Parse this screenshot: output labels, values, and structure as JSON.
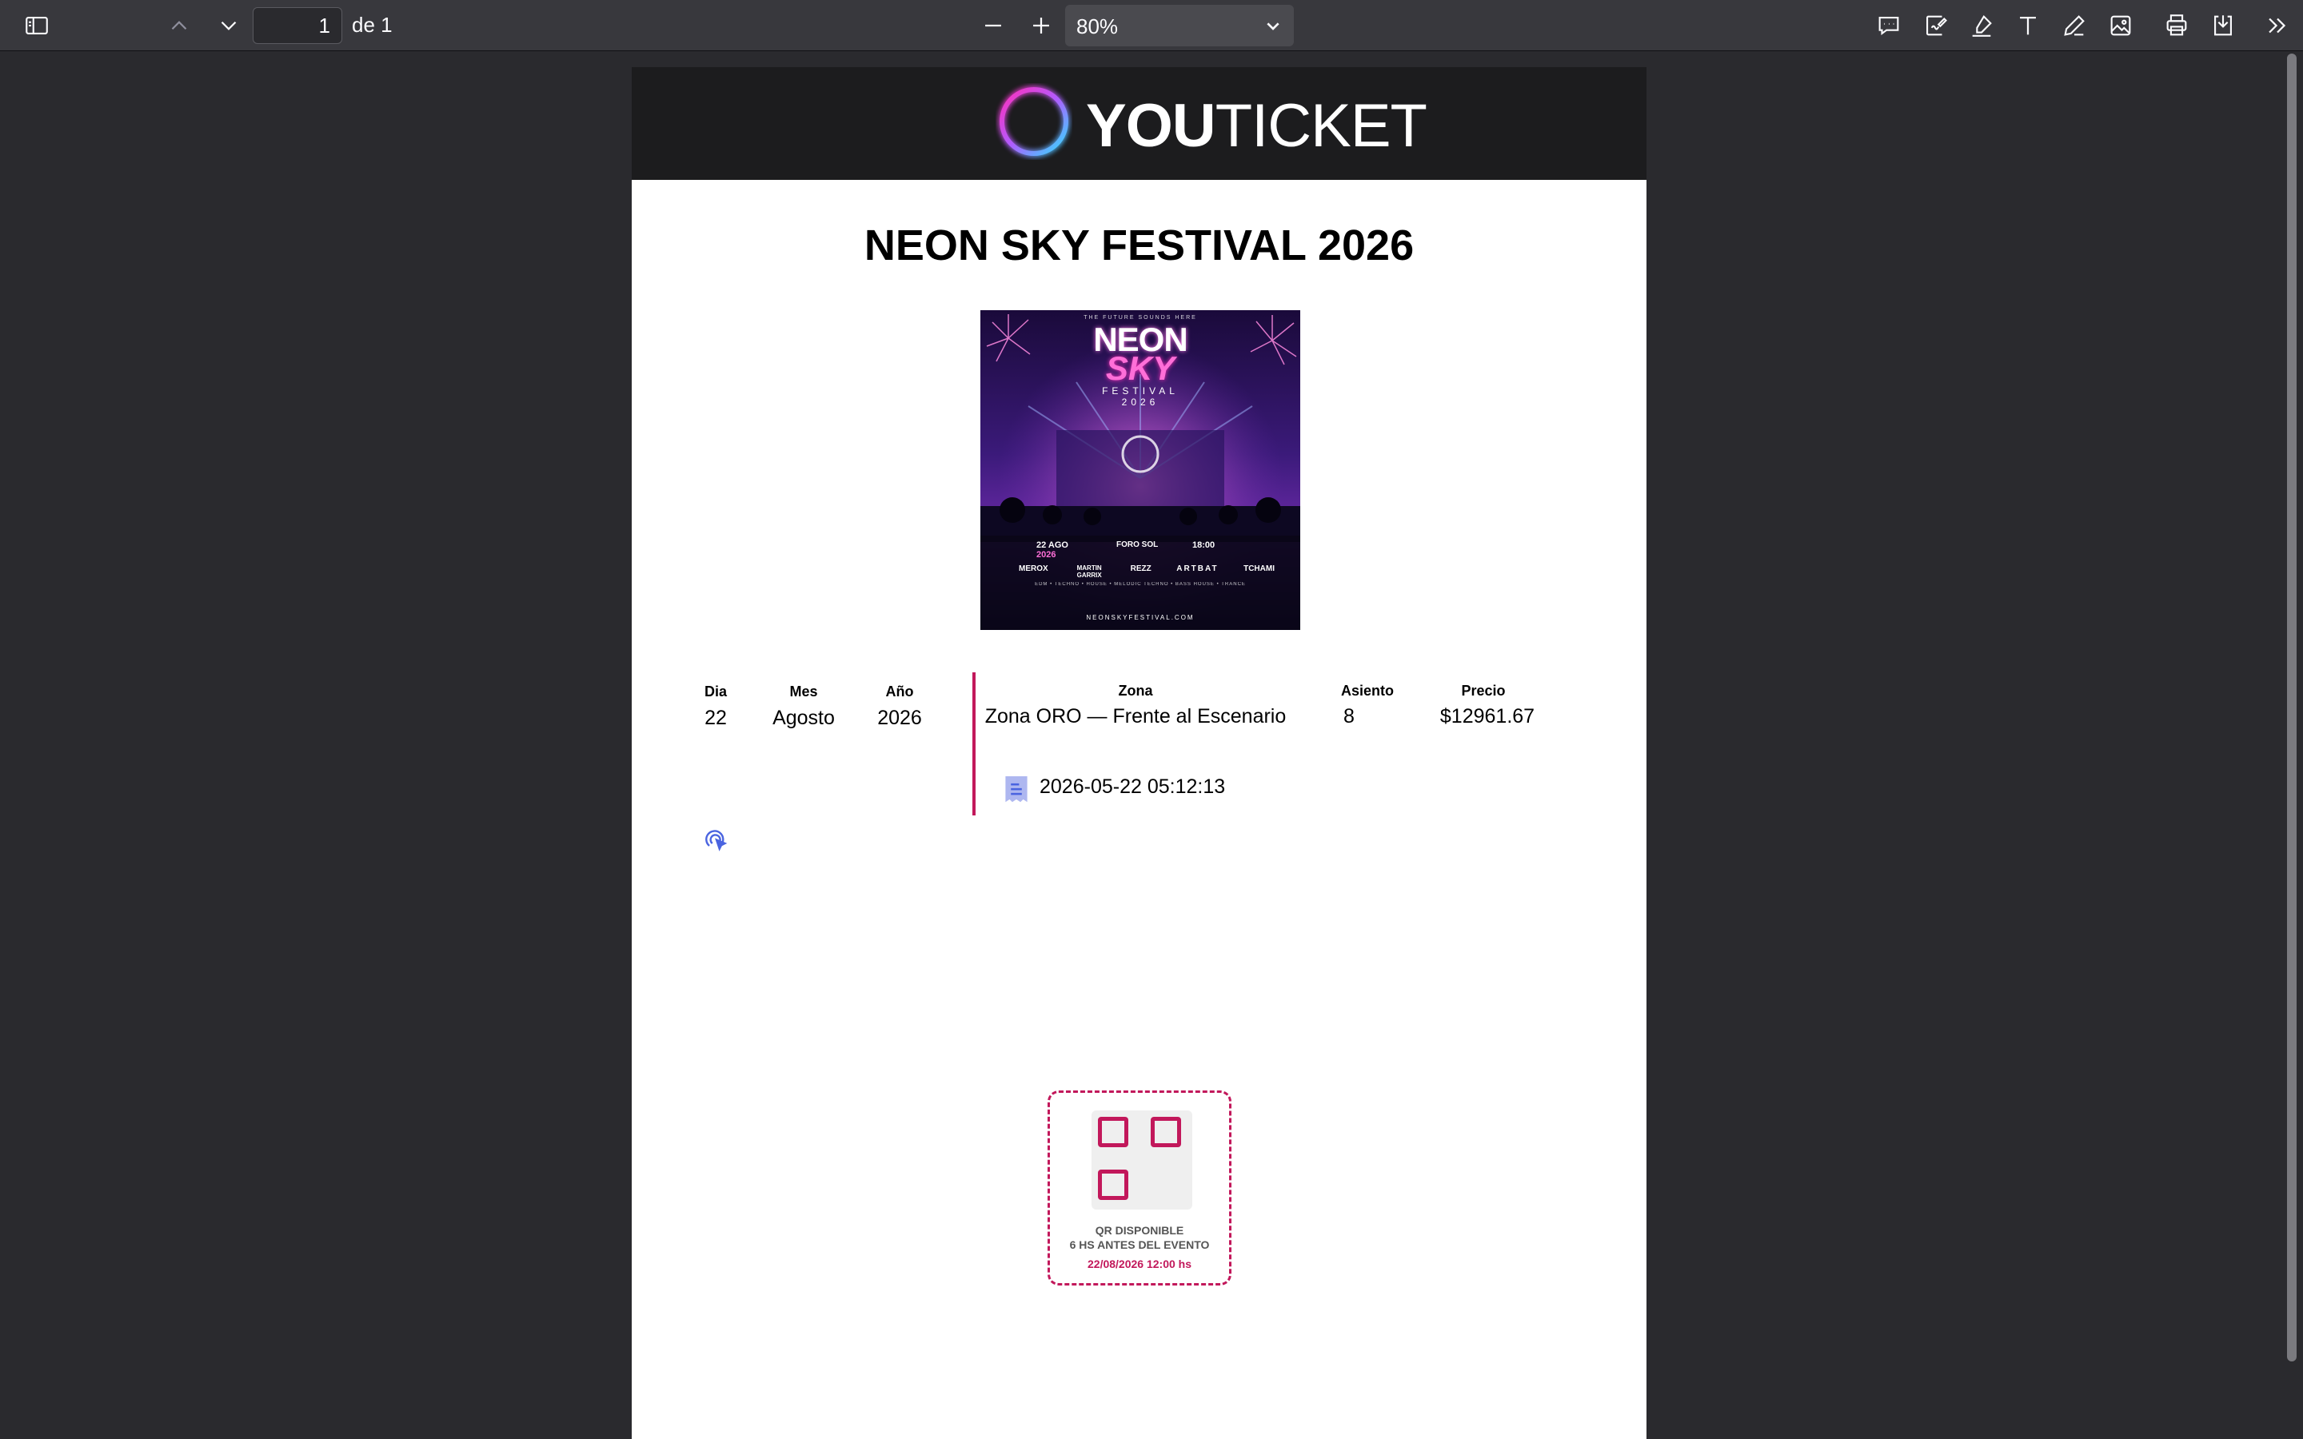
{
  "toolbar": {
    "page_current": "1",
    "page_of": "de 1",
    "zoom": "80%"
  },
  "ticket": {
    "brand_you": "YOU",
    "brand_ticket": "TICKET",
    "event_title": "NEON SKY FESTIVAL 2026",
    "poster": {
      "tagline": "THE FUTURE SOUNDS HERE",
      "line1": "NEON",
      "line2": "SKY",
      "line3": "FESTIVAL",
      "line4": "2026",
      "date": "22 AGO",
      "date_year": "2026",
      "venue": "FORO SOL",
      "time": "18:00",
      "lineup": [
        "MEROX",
        "MARTIN GARRIX",
        "REZZ",
        "ARTBAT",
        "TCHAMI"
      ],
      "genres": "EDM • TECHNO • HOUSE • MELODIC TECHNO • BASS HOUSE • TRANCE",
      "url": "NEONSKYFESTIVAL.COM"
    },
    "labels": {
      "dia": "Dia",
      "mes": "Mes",
      "anio": "Año",
      "zona": "Zona",
      "asiento": "Asiento",
      "precio": "Precio"
    },
    "values": {
      "dia": "22",
      "mes": "Agosto",
      "anio": "2026",
      "zona": "Zona ORO — Frente al Escenario",
      "asiento": "8",
      "precio": "$12961.67",
      "timestamp": "2026-05-22 05:12:13"
    },
    "qr": {
      "line1": "QR DISPONIBLE",
      "line2": "6 HS ANTES DEL EVENTO",
      "line3": "22/08/2026 12:00 hs"
    }
  },
  "colors": {
    "accent": "#c2185b",
    "toolbar_bg": "#38383d",
    "viewer_bg": "#2a2a2e"
  }
}
